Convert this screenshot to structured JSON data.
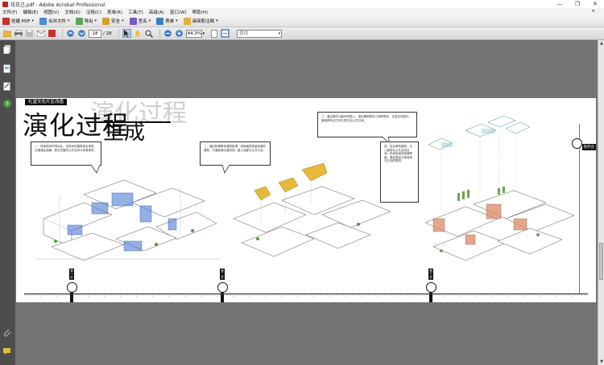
{
  "window": {
    "title": "花花己.pdf - Adobe Acrobat Professional",
    "controls": [
      "—",
      "❐",
      "✕"
    ]
  },
  "menu": {
    "items": [
      "文件(F)",
      "编辑(E)",
      "视图(V)",
      "文档(D)",
      "注释(C)",
      "表单(R)",
      "工具(T)",
      "高级(A)",
      "窗口(W)",
      "帮助(H)"
    ],
    "close": "×"
  },
  "toolbar1": {
    "create_pdf": "创建 PDF",
    "combine": "合并文件",
    "export": "导出",
    "secure": "安全",
    "sign": "签名",
    "forms": "表单",
    "review": "审阅和注释"
  },
  "toolbar2": {
    "page_current": "18",
    "page_total": "/ 28",
    "zoom": "44.3%",
    "search_placeholder": "查找"
  },
  "document": {
    "badge": "礼堂文化片区改造",
    "title_main": "演化过程",
    "title_ghost": "演化过程",
    "title_sub": "生成",
    "side_label": "现存合",
    "node_labels": [
      "第一步",
      "第二步",
      "第三步"
    ],
    "node_texts": [
      "1/2\n...",
      "2\n...",
      "3\n..."
    ],
    "callout1": "一、场地现状环境杂乱，无秩序的建筑相互堆叠，交通混乱拥堵，缺乏完整的公共空间与休憩场所。",
    "callout2": "二、通过梳理原有建筑肌理，拆除破损质量较差的建筑，打通街巷交通流线，植入连廊与公共平台。",
    "callout3": "三、通过新的功能体块插入，强化建筑群体之间的联系，丰富空间层次，营造具有活力的礼堂文化公共空间。",
    "callout4": "四、结合原有建筑，引入景观与公共活动空间，形成连续的街巷界面，满足居民日常休闲与交流的需求。"
  },
  "colors": {
    "accent_blue": "#3f6fd1",
    "accent_yellow": "#e8b83a",
    "accent_orange": "#d98a66",
    "accent_green": "#6aa84f",
    "accent_cyan": "#7fb9c9"
  }
}
